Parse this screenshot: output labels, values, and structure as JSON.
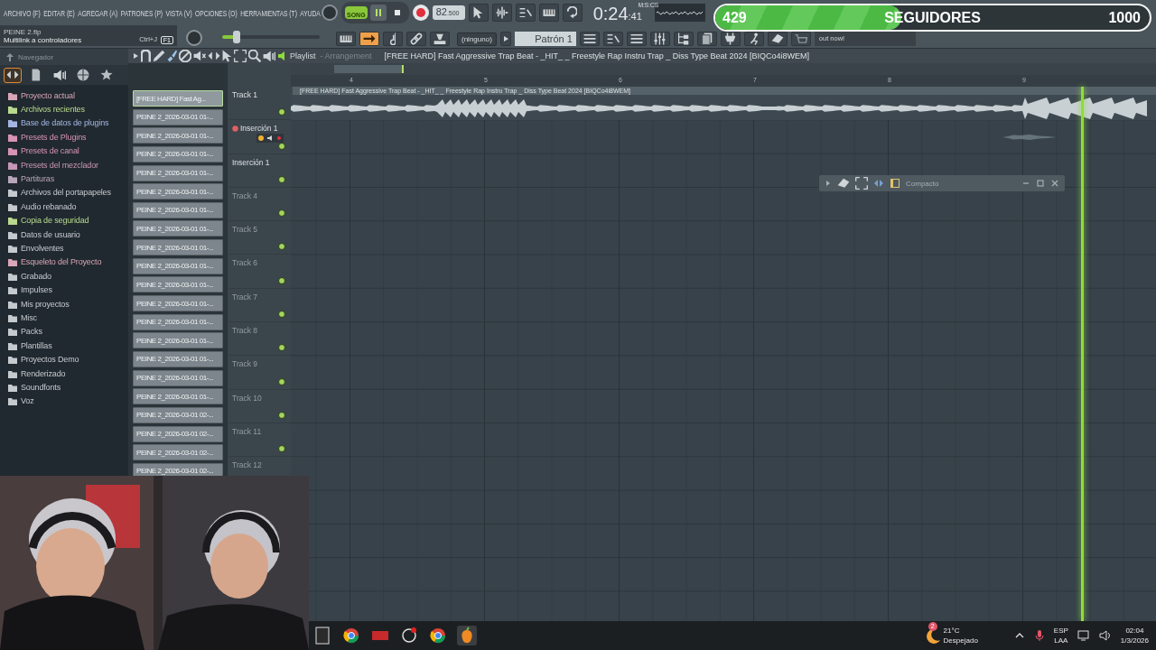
{
  "menu": [
    "ARCHIVO (F)",
    "EDITAR (E)",
    "AGREGAR (A)",
    "PATRONES (P)",
    "VISTA (V)",
    "OPCIONES (O)",
    "HERRAMIENTAS (T)",
    "AYUDA"
  ],
  "hint": {
    "file": "PEINE 2.flp",
    "text": "Multilink a controladores",
    "shortcut": "Ctrl+J",
    "key": "F1"
  },
  "master_volume": {
    "level": 0.15
  },
  "transport": {
    "modes": [
      {
        "label": "SONG",
        "selected": true
      }
    ]
  },
  "tempo": {
    "value": "82",
    "fraction": ".500"
  },
  "time": {
    "main": "0:24",
    "small": ":41",
    "unit": "M:S:CS"
  },
  "snap": "(ninguno)",
  "pattern": "Patrón 1",
  "news": "out now!",
  "followers": {
    "current": "429",
    "label": "SEGUIDORES",
    "goal": "1000",
    "level": 0.429
  },
  "browser": {
    "title": "Navegador",
    "tabs": [
      {
        "selected": true
      },
      {
        "selected": false
      },
      {
        "selected": false
      },
      {
        "selected": false
      },
      {
        "selected": false
      }
    ],
    "items": [
      {
        "label": "Proyecto actual",
        "color": "#d9a6b8"
      },
      {
        "label": "Archivos recientes",
        "color": "#b9d98f"
      },
      {
        "label": "Base de datos de plugins",
        "color": "#a4b5e3"
      },
      {
        "label": "Presets de Plugins",
        "color": "#d793b4"
      },
      {
        "label": "Presets de canal",
        "color": "#d793b4"
      },
      {
        "label": "Presets del mezclador",
        "color": "#c896b6"
      },
      {
        "label": "Partituras",
        "color": "#b9a5bb"
      },
      {
        "label": "Archivos del portapapeles",
        "color": "#c5cacf"
      },
      {
        "label": "Audio rebanado",
        "color": "#c5cacf"
      },
      {
        "label": "Copia de seguridad",
        "color": "#b9d98f"
      },
      {
        "label": "Datos de usuario",
        "color": "#c5cacf"
      },
      {
        "label": "Envolventes",
        "color": "#c5cacf"
      },
      {
        "label": "Esqueleto del Proyecto",
        "color": "#d9a6b8"
      },
      {
        "label": "Grabado",
        "color": "#c5cacf"
      },
      {
        "label": "Impulses",
        "color": "#c5cacf"
      },
      {
        "label": "Mis proyectos",
        "color": "#c5cacf"
      },
      {
        "label": "Misc",
        "color": "#c5cacf"
      },
      {
        "label": "Packs",
        "color": "#c5cacf"
      },
      {
        "label": "Plantillas",
        "color": "#c5cacf"
      },
      {
        "label": "Proyectos Demo",
        "color": "#c5cacf"
      },
      {
        "label": "Renderizado",
        "color": "#c5cacf"
      },
      {
        "label": "Soundfonts",
        "color": "#c5cacf"
      },
      {
        "label": "Voz",
        "color": "#c5cacf"
      }
    ]
  },
  "channels": [
    {
      "label": "[FREE HARD] Fast Ag...",
      "selected": true
    },
    {
      "label": "PEINE 2_2026-03-01 01-...",
      "selected": false
    },
    {
      "label": "PEINE 2_2026-03-01 01-...",
      "selected": false
    },
    {
      "label": "PEINE 2_2026-03-01 01-...",
      "selected": false
    },
    {
      "label": "PEINE 2_2026-03-01 01-...",
      "selected": false
    },
    {
      "label": "PEINE 2_2026-03-01 01-...",
      "selected": false
    },
    {
      "label": "PEINE 2_2026-03-01 01-...",
      "selected": false
    },
    {
      "label": "PEINE 2_2026-03-01 01-...",
      "selected": false
    },
    {
      "label": "PEINE 2_2026-03-01 01-...",
      "selected": false
    },
    {
      "label": "PEINE 2_2026-03-01 01-...",
      "selected": false
    },
    {
      "label": "PEINE 2_2026-03-01 01-...",
      "selected": false
    },
    {
      "label": "PEINE 2_2026-03-01 01-...",
      "selected": false
    },
    {
      "label": "PEINE 2_2026-03-01 01-...",
      "selected": false
    },
    {
      "label": "PEINE 2_2026-03-01 01-...",
      "selected": false
    },
    {
      "label": "PEINE 2_2026-03-01 01-...",
      "selected": false
    },
    {
      "label": "PEINE 2_2026-03-01 01-...",
      "selected": false
    },
    {
      "label": "PEINE 2_2026-03-01 01-...",
      "selected": false
    },
    {
      "label": "PEINE 2_2026-03-01 02-...",
      "selected": false
    },
    {
      "label": "PEINE 2_2026-03-01 02-...",
      "selected": false
    },
    {
      "label": "PEINE 2_2026-03-01 02-...",
      "selected": false
    },
    {
      "label": "PEINE 2_2026-03-01 02-...",
      "selected": false
    }
  ],
  "playlist": {
    "title": "Playlist",
    "subtitle": "- Arrangement",
    "song": "[FREE HARD] Fast Aggressive Trap Beat - _HIT_ _ Freestyle Rap Instru Trap _ Diss Type Beat 2024 [BIQCo4i8WEM]",
    "ruler": [
      "4",
      "5",
      "6",
      "7",
      "8",
      "9"
    ],
    "clip": "[FREE HARD] Fast Aggressive Trap Beat - _HIT_ _ Freestyle Rap Instru Trap _ Diss Type Beat 2024 [BIQCo4i8WEM]",
    "playhead": {
      "level": 0.913
    },
    "tracks": [
      {
        "name": "Track 1",
        "empty": false,
        "kind": "track"
      },
      {
        "name": "Inserción 1",
        "empty": false,
        "kind": "insert"
      },
      {
        "name": "Inserción 1",
        "empty": false,
        "kind": "track"
      },
      {
        "name": "Track 4",
        "empty": true,
        "kind": "track"
      },
      {
        "name": "Track 5",
        "empty": true,
        "kind": "track"
      },
      {
        "name": "Track 6",
        "empty": true,
        "kind": "track"
      },
      {
        "name": "Track 7",
        "empty": true,
        "kind": "track"
      },
      {
        "name": "Track 8",
        "empty": true,
        "kind": "track"
      },
      {
        "name": "Track 9",
        "empty": true,
        "kind": "track"
      },
      {
        "name": "Track 10",
        "empty": true,
        "kind": "track"
      },
      {
        "name": "Track 11",
        "empty": true,
        "kind": "track"
      },
      {
        "name": "Track 12",
        "empty": true,
        "kind": "track"
      }
    ],
    "compact": {
      "title": "Compacto"
    }
  },
  "taskbar": {
    "weather": {
      "badge": "2",
      "temp": "21°C",
      "condition": "Despejado"
    },
    "language": "ESP",
    "layout": "LAA",
    "time": "02:04",
    "date": "1/3/2026"
  }
}
